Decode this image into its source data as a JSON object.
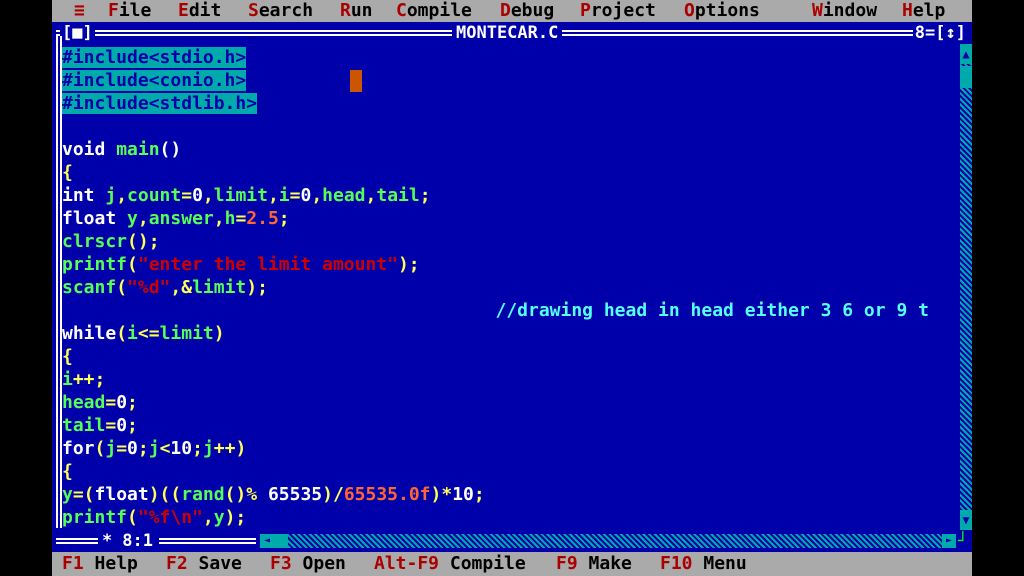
{
  "menu": {
    "system_icon": "≡",
    "items": [
      {
        "hot": "F",
        "rest": "ile"
      },
      {
        "hot": "E",
        "rest": "dit"
      },
      {
        "hot": "S",
        "rest": "earch"
      },
      {
        "hot": "R",
        "rest": "un"
      },
      {
        "hot": "C",
        "rest": "ompile"
      },
      {
        "hot": "D",
        "rest": "ebug"
      },
      {
        "hot": "P",
        "rest": "roject"
      },
      {
        "hot": "O",
        "rest": "ptions"
      },
      {
        "hot": "W",
        "rest": "indow"
      },
      {
        "hot": "H",
        "rest": "elp"
      }
    ]
  },
  "window": {
    "title": "MONTECAR.C",
    "close_box": "[■]",
    "number": "8",
    "zoom_box": "[↕]"
  },
  "status": {
    "position": "8:1"
  },
  "code_lines": [
    [
      {
        "t": "#include<stdio.h>",
        "c": "hl"
      }
    ],
    [
      {
        "t": "#include<conio.h>",
        "c": "hl"
      }
    ],
    [
      {
        "t": "#include<stdlib.h>",
        "c": "hl"
      }
    ],
    [
      {
        "t": "",
        "c": "kw"
      }
    ],
    [
      {
        "t": "void ",
        "c": "kw"
      },
      {
        "t": "main",
        "c": "id"
      },
      {
        "t": "()",
        "c": "kw"
      }
    ],
    [
      {
        "t": "{",
        "c": "op"
      }
    ],
    [
      {
        "t": "int ",
        "c": "kw"
      },
      {
        "t": "j",
        "c": "id"
      },
      {
        "t": ",",
        "c": "op"
      },
      {
        "t": "count",
        "c": "id"
      },
      {
        "t": "=",
        "c": "op"
      },
      {
        "t": "0",
        "c": "kw"
      },
      {
        "t": ",",
        "c": "op"
      },
      {
        "t": "limit",
        "c": "id"
      },
      {
        "t": ",",
        "c": "op"
      },
      {
        "t": "i",
        "c": "id"
      },
      {
        "t": "=",
        "c": "op"
      },
      {
        "t": "0",
        "c": "kw"
      },
      {
        "t": ",",
        "c": "op"
      },
      {
        "t": "head",
        "c": "id"
      },
      {
        "t": ",",
        "c": "op"
      },
      {
        "t": "tail",
        "c": "id"
      },
      {
        "t": ";",
        "c": "op"
      }
    ],
    [
      {
        "t": "float ",
        "c": "kw"
      },
      {
        "t": "y",
        "c": "id"
      },
      {
        "t": ",",
        "c": "op"
      },
      {
        "t": "answer",
        "c": "id"
      },
      {
        "t": ",",
        "c": "op"
      },
      {
        "t": "h",
        "c": "id"
      },
      {
        "t": "=",
        "c": "op"
      },
      {
        "t": "2.5",
        "c": "num"
      },
      {
        "t": ";",
        "c": "op"
      }
    ],
    [
      {
        "t": "clrscr",
        "c": "id"
      },
      {
        "t": "();",
        "c": "op"
      }
    ],
    [
      {
        "t": "printf",
        "c": "id"
      },
      {
        "t": "(",
        "c": "op"
      },
      {
        "t": "\"enter the limit amount\"",
        "c": "str"
      },
      {
        "t": ");",
        "c": "op"
      }
    ],
    [
      {
        "t": "scanf",
        "c": "id"
      },
      {
        "t": "(",
        "c": "op"
      },
      {
        "t": "\"%d\"",
        "c": "str"
      },
      {
        "t": ",&",
        "c": "op"
      },
      {
        "t": "limit",
        "c": "id"
      },
      {
        "t": ");",
        "c": "op"
      }
    ],
    [
      {
        "t": "                                        //drawing head in head either 3 6 or 9 t",
        "c": "cm"
      }
    ],
    [
      {
        "t": "while",
        "c": "kw"
      },
      {
        "t": "(",
        "c": "op"
      },
      {
        "t": "i",
        "c": "id"
      },
      {
        "t": "<=",
        "c": "op"
      },
      {
        "t": "limit",
        "c": "id"
      },
      {
        "t": ")",
        "c": "op"
      }
    ],
    [
      {
        "t": "{",
        "c": "op"
      }
    ],
    [
      {
        "t": "i",
        "c": "id"
      },
      {
        "t": "++;",
        "c": "op"
      }
    ],
    [
      {
        "t": "head",
        "c": "id"
      },
      {
        "t": "=",
        "c": "op"
      },
      {
        "t": "0",
        "c": "kw"
      },
      {
        "t": ";",
        "c": "op"
      }
    ],
    [
      {
        "t": "tail",
        "c": "id"
      },
      {
        "t": "=",
        "c": "op"
      },
      {
        "t": "0",
        "c": "kw"
      },
      {
        "t": ";",
        "c": "op"
      }
    ],
    [
      {
        "t": "for",
        "c": "kw"
      },
      {
        "t": "(",
        "c": "op"
      },
      {
        "t": "j",
        "c": "id"
      },
      {
        "t": "=",
        "c": "op"
      },
      {
        "t": "0",
        "c": "kw"
      },
      {
        "t": ";",
        "c": "op"
      },
      {
        "t": "j",
        "c": "id"
      },
      {
        "t": "<",
        "c": "op"
      },
      {
        "t": "10",
        "c": "kw"
      },
      {
        "t": ";",
        "c": "op"
      },
      {
        "t": "j",
        "c": "id"
      },
      {
        "t": "++)",
        "c": "op"
      }
    ],
    [
      {
        "t": "{",
        "c": "op"
      }
    ],
    [
      {
        "t": "y",
        "c": "id"
      },
      {
        "t": "=(",
        "c": "op"
      },
      {
        "t": "float",
        "c": "kw"
      },
      {
        "t": ")((",
        "c": "op"
      },
      {
        "t": "rand",
        "c": "id"
      },
      {
        "t": "()% ",
        "c": "op"
      },
      {
        "t": "65535",
        "c": "kw"
      },
      {
        "t": ")/",
        "c": "op"
      },
      {
        "t": "65535.0f",
        "c": "num"
      },
      {
        "t": ")*",
        "c": "op"
      },
      {
        "t": "10",
        "c": "kw"
      },
      {
        "t": ";",
        "c": "op"
      }
    ],
    [
      {
        "t": "printf",
        "c": "id"
      },
      {
        "t": "(",
        "c": "op"
      },
      {
        "t": "\"%f\\n\"",
        "c": "str"
      },
      {
        "t": ",",
        "c": "op"
      },
      {
        "t": "y",
        "c": "id"
      },
      {
        "t": ");",
        "c": "op"
      }
    ]
  ],
  "function_keys": [
    {
      "key": "F1",
      "label": " Help"
    },
    {
      "key": "F2",
      "label": " Save"
    },
    {
      "key": "F3",
      "label": " Open"
    },
    {
      "key": "Alt-F9",
      "label": " Compile"
    },
    {
      "key": "F9",
      "label": " Make"
    },
    {
      "key": "F10",
      "label": " Menu"
    }
  ],
  "colors": {
    "background": "#0000AA",
    "menu_bg": "#AAAAAA",
    "hotkey": "#AA0000",
    "highlight": "#00AAAA"
  }
}
